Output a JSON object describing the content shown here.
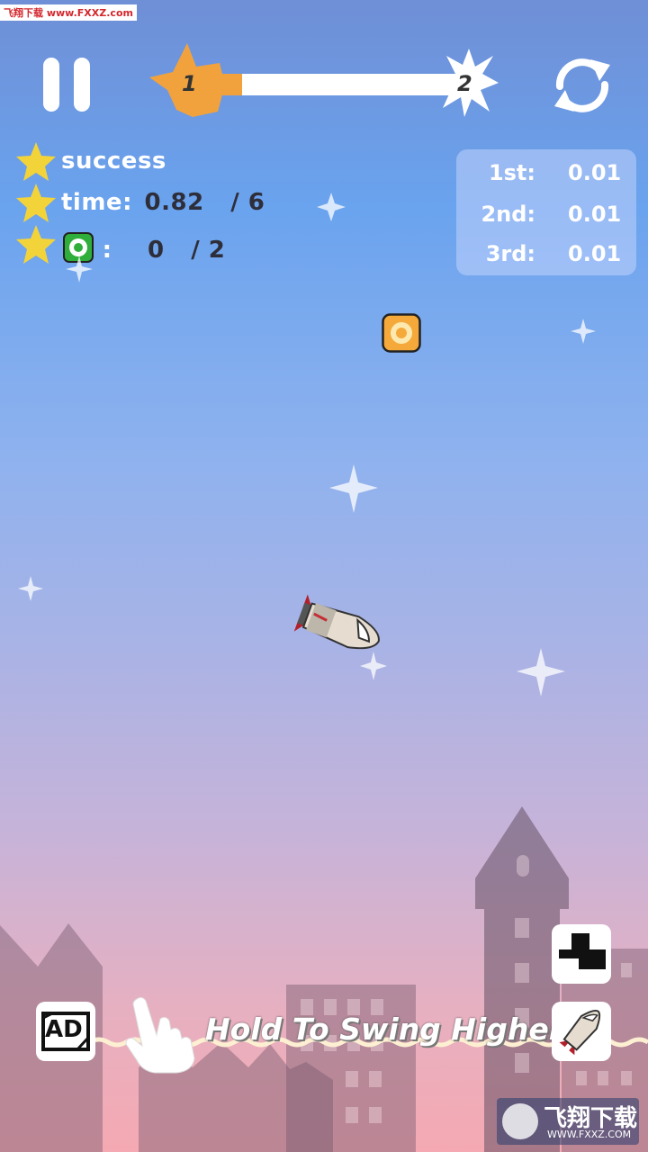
{
  "watermark_top": "飞翔下载 www.FXXZ.com",
  "progress": {
    "from_level": "1",
    "to_level": "2",
    "fraction": 0.13
  },
  "objectives": [
    {
      "label": "success"
    },
    {
      "label": "time:",
      "value": "0.82",
      "target": "/ 6"
    },
    {
      "label": ":",
      "value": "0",
      "target": "/ 2"
    }
  ],
  "ranking": [
    {
      "place": "1st:",
      "value": "0.01"
    },
    {
      "place": "2nd:",
      "value": "0.01"
    },
    {
      "place": "3rd:",
      "value": "0.01"
    }
  ],
  "tip": "Hold To Swing Higher",
  "ad_label": "AD",
  "watermark_bottom": {
    "title": "飞翔下载",
    "url": "WWW.FXXZ.COM"
  },
  "colors": {
    "progress": "#f2a23d",
    "star": "#f3d33a",
    "coin": "#f4a93a",
    "target_green": "#2fae3b"
  },
  "icons": [
    "pause-icon",
    "restart-icon",
    "star-icon",
    "target-icon",
    "coin-icon",
    "rocket-icon",
    "hand-icon",
    "ad-icon",
    "switch-icon"
  ]
}
